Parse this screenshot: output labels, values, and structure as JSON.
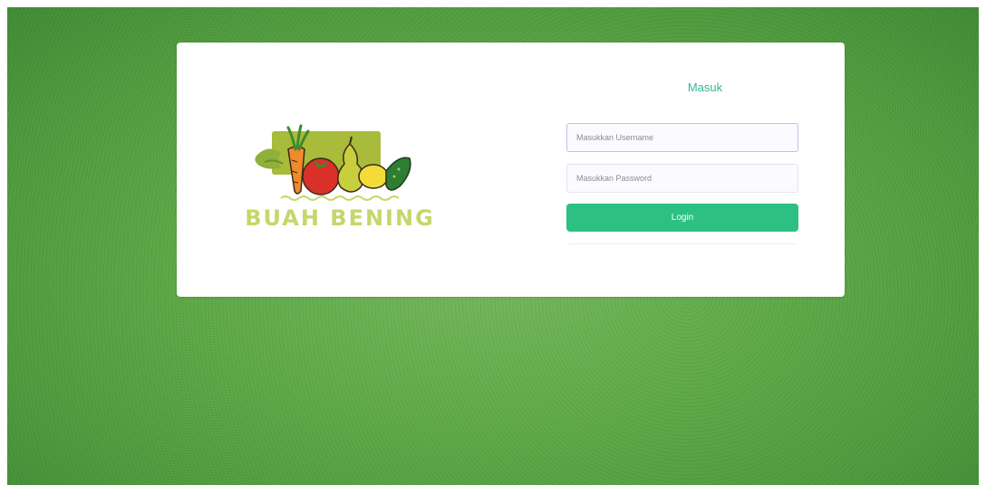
{
  "logo": {
    "brand_text": "BUAH BENING",
    "icon": "fruit-vegetable-logo",
    "accent_color": "#c5d76a"
  },
  "form": {
    "title": "Masuk",
    "username_placeholder": "Masukkan Username",
    "password_placeholder": "Masukkan Password",
    "login_label": "Login",
    "button_color": "#2dc083",
    "title_color": "#36b494"
  },
  "background": {
    "texture": "grass",
    "color": "#5da846"
  }
}
